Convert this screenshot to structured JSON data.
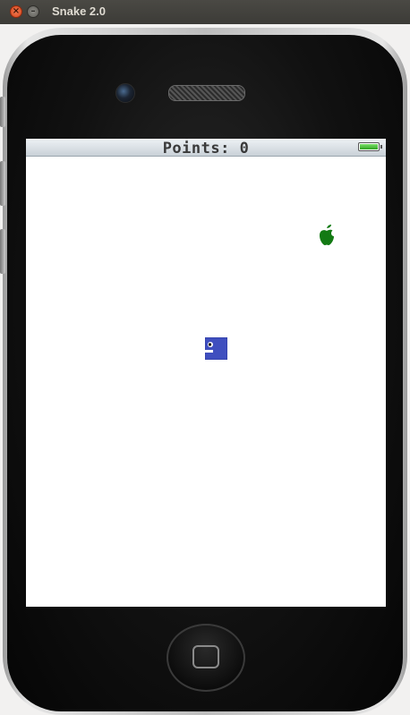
{
  "window": {
    "title": "Snake 2.0",
    "close_glyph": "×",
    "minimize_glyph": "–"
  },
  "status": {
    "points_label": "Points: 0",
    "battery_level": 1.0
  },
  "game": {
    "apple_icon": "apple-icon",
    "snake_color": "#3f4fbf",
    "apple_color": "#137a14"
  }
}
